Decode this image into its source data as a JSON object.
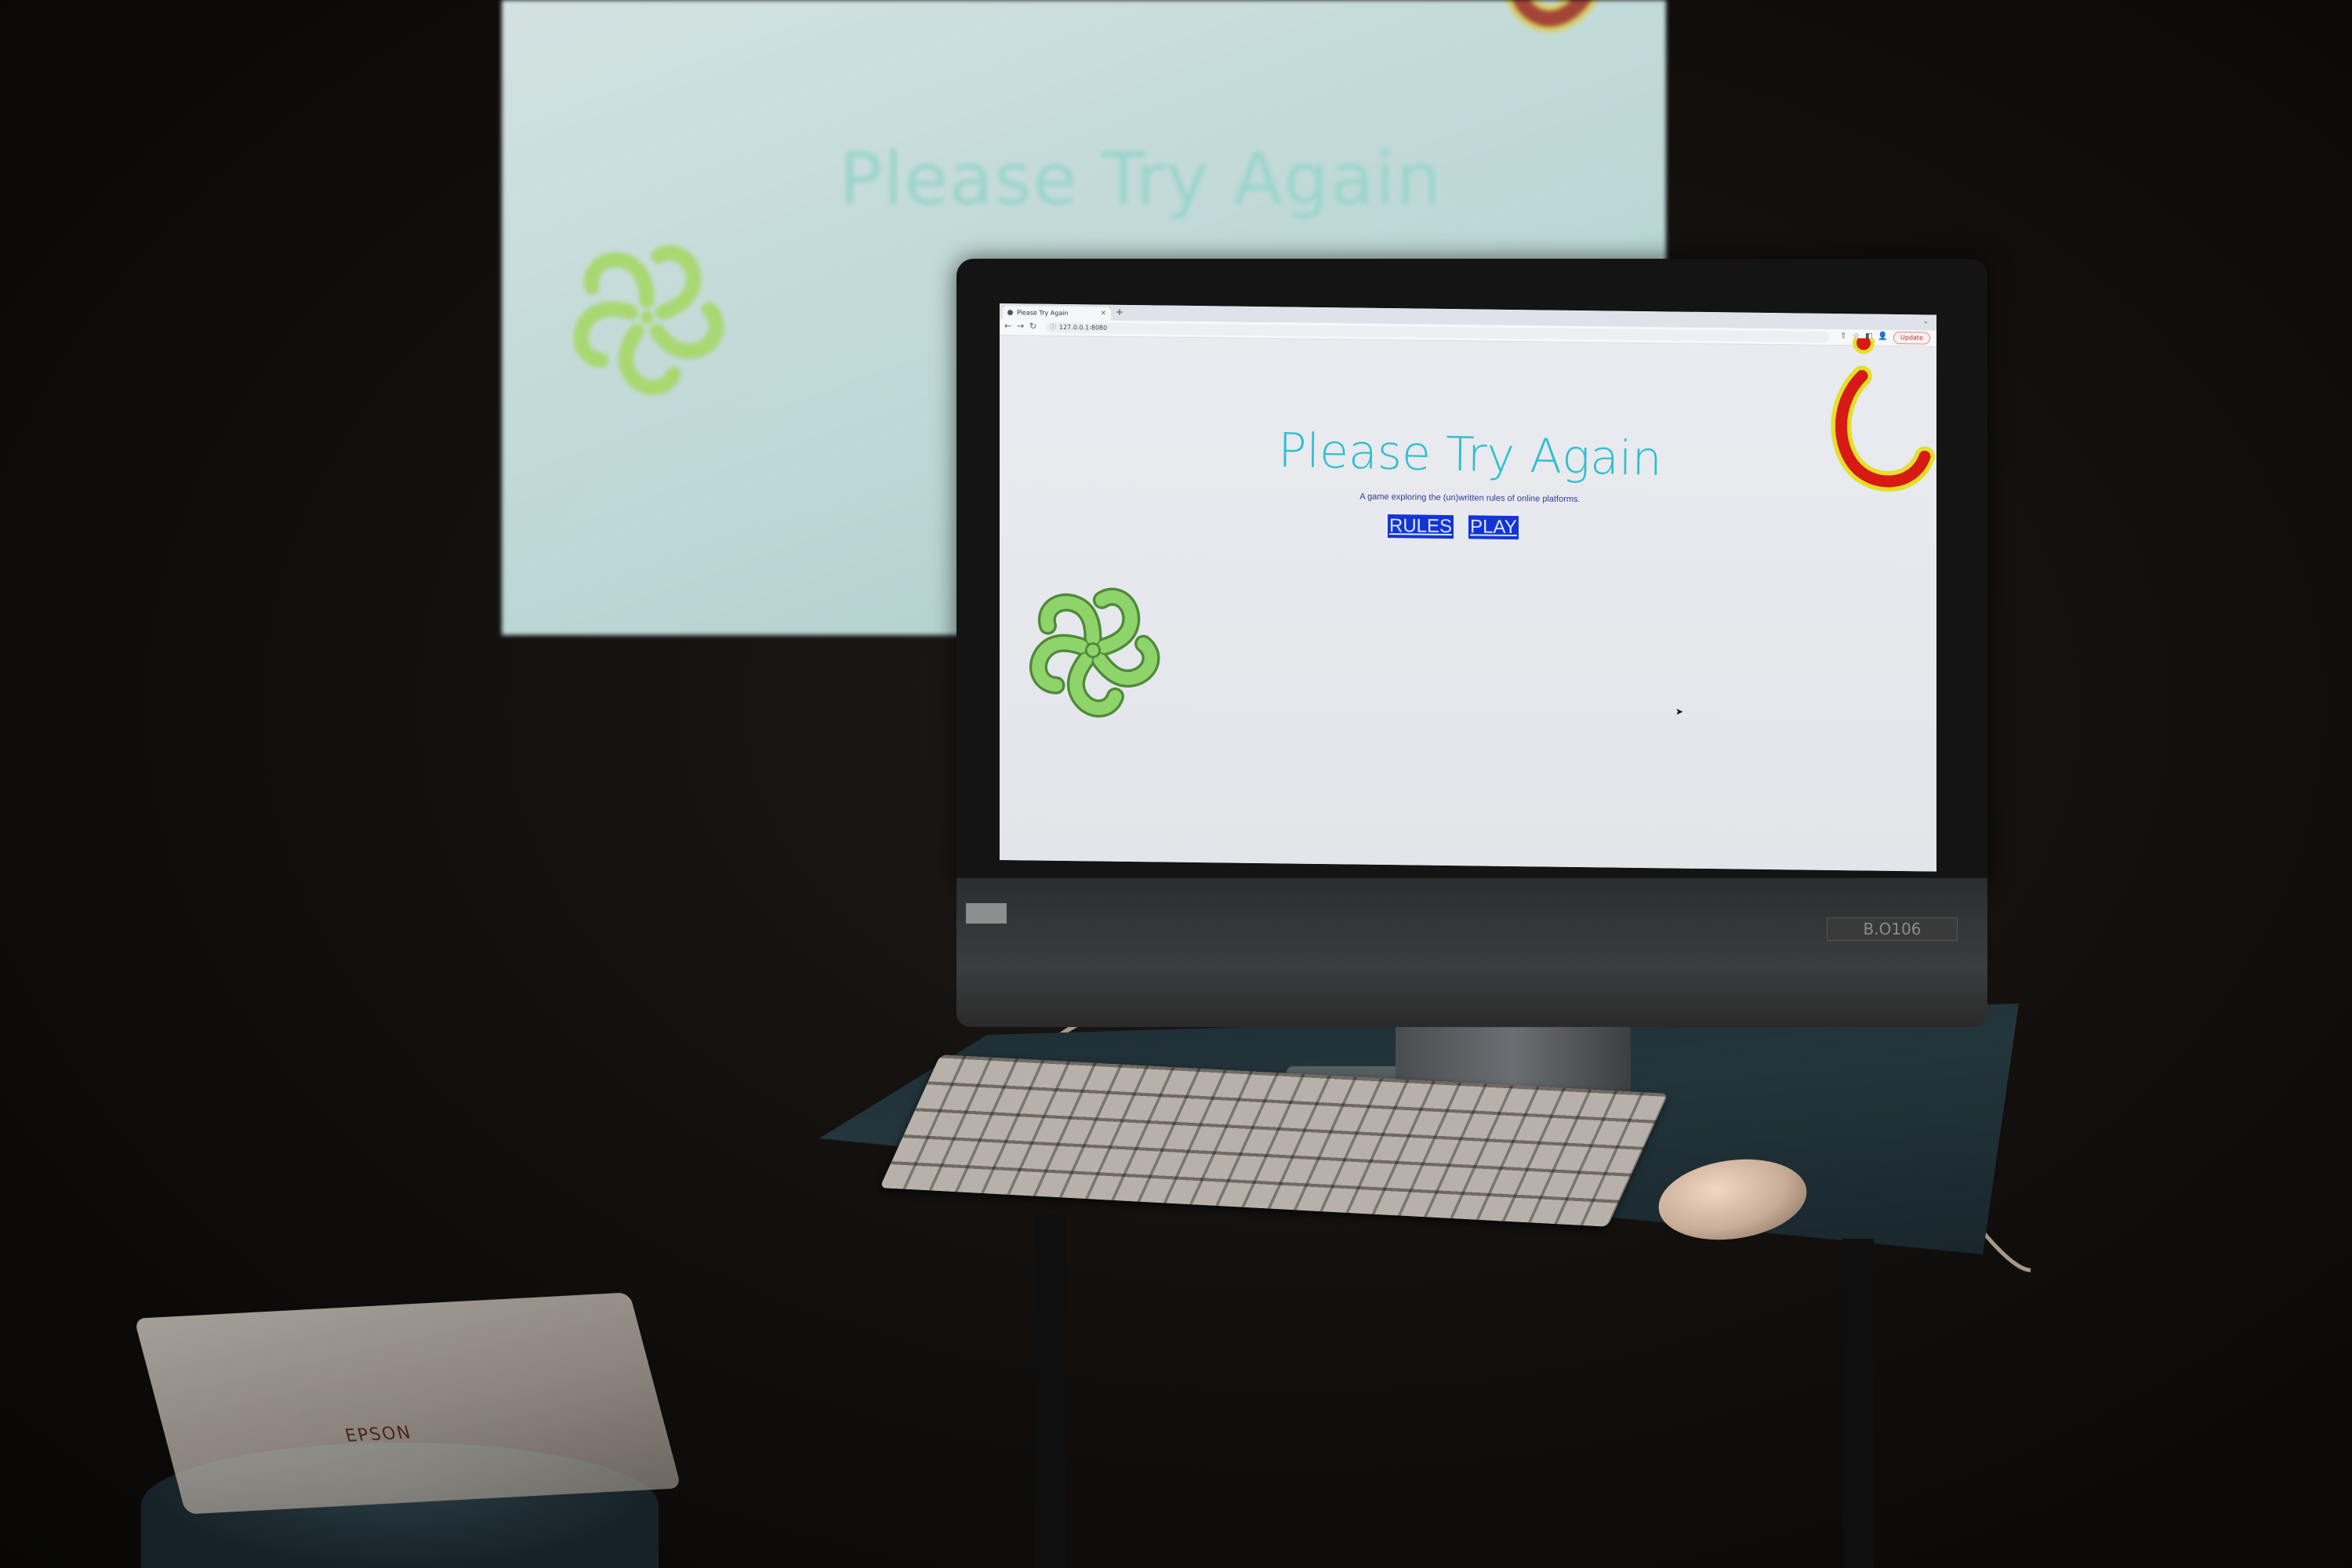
{
  "projection": {
    "title": "Please Try Again"
  },
  "browser": {
    "tab_title": "Please Try Again",
    "tab_close": "×",
    "new_tab": "+",
    "tab_menu": "⌄",
    "url": "127.0.0.1:8080",
    "update_label": "Update",
    "nav_back": "←",
    "nav_forward": "→",
    "nav_reload": "↻",
    "url_icon": "ⓘ",
    "tool_icons": [
      "⇧",
      "☆",
      "◧",
      "👤"
    ]
  },
  "page": {
    "title": "Please Try Again",
    "subtitle": "A game exploring the (un)written rules of online platforms.",
    "rules_label": "RULES",
    "play_label": "PLAY",
    "cursor": "➤"
  },
  "device": {
    "asset_tag": "B.O106",
    "apple_logo": ""
  },
  "projector": {
    "brand": "EPSON"
  },
  "colors": {
    "title": "#2fbfd0",
    "button_bg": "#1534d6",
    "flower": "#8fd46a",
    "hook_fill": "#d71a14",
    "hook_outline": "#e4e02a"
  },
  "icons": {
    "flower": "question-mark-flower-icon",
    "hook": "inverted-question-mark-icon"
  }
}
